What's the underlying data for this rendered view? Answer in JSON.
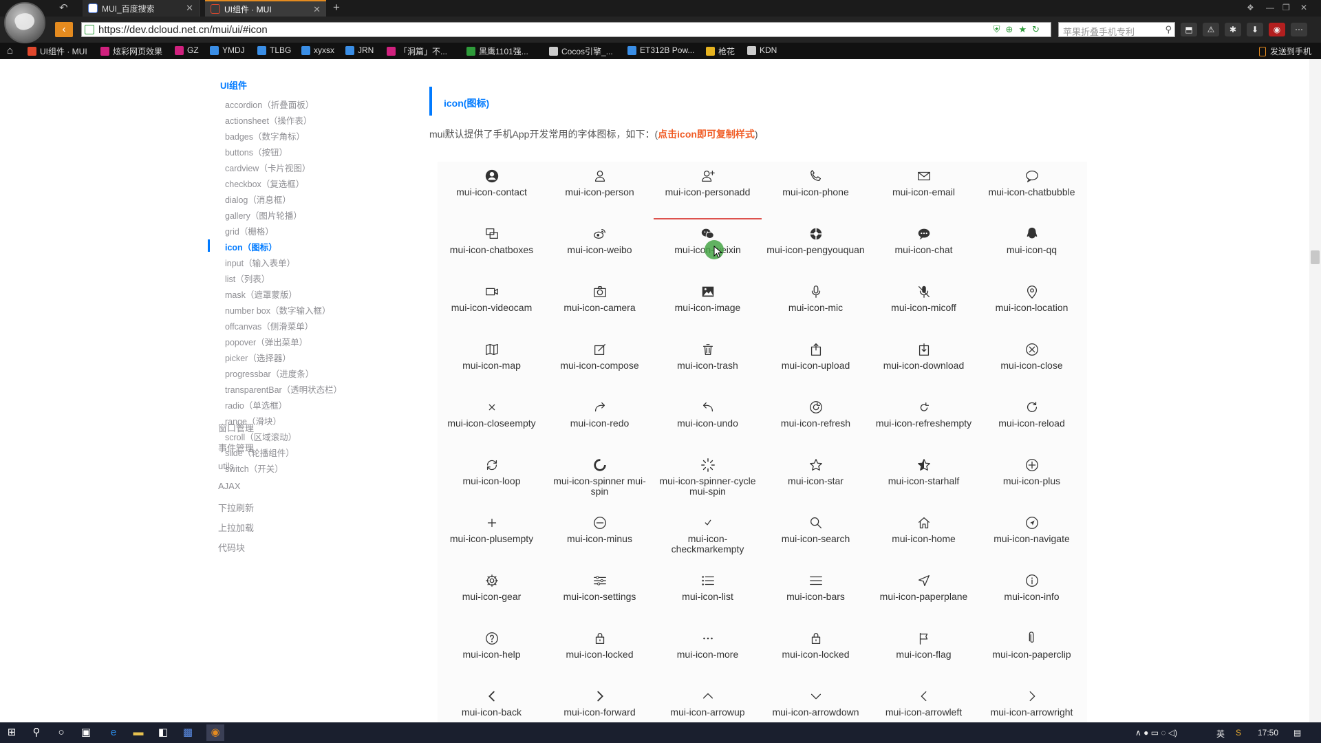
{
  "browser": {
    "tabs": [
      {
        "label": "MUI_百度搜索"
      },
      {
        "label": "UI组件 · MUI"
      }
    ],
    "url": "https://dev.dcloud.net.cn/mui/ui/#icon",
    "search_placeholder": "苹果折叠手机专利",
    "bookmarks": [
      {
        "label": "UI组件 · MUI",
        "color": "#e0472c"
      },
      {
        "label": "炫彩网页效果",
        "color": "#d0217e"
      },
      {
        "label": "GZ",
        "color": "#d0217e"
      },
      {
        "label": "YMDJ",
        "color": "#3a8ee6"
      },
      {
        "label": "TLBG",
        "color": "#3a8ee6"
      },
      {
        "label": "xyxsx",
        "color": "#3a8ee6"
      },
      {
        "label": "JRN",
        "color": "#3a8ee6"
      },
      {
        "label": "「洞篇」不...",
        "color": "#d0217e"
      },
      {
        "label": "黑鹰1101强...",
        "color": "#2e9b3a"
      },
      {
        "label": "Cocos引擎_...",
        "color": "#cccccc"
      },
      {
        "label": "ET312B Pow...",
        "color": "#3a8ee6"
      },
      {
        "label": "枪花",
        "color": "#e5b21f"
      },
      {
        "label": "KDN",
        "color": "#cccccc"
      }
    ],
    "send_to_phone": "发送到手机"
  },
  "sidebar": {
    "title": "UI组件",
    "items": [
      "accordion（折叠面板）",
      "actionsheet（操作表）",
      "badges（数字角标）",
      "buttons（按钮）",
      "cardview（卡片视图）",
      "checkbox（复选框）",
      "dialog（消息框）",
      "gallery（图片轮播）",
      "grid（栅格）",
      "icon（图标）",
      "input（输入表单）",
      "list（列表）",
      "mask（遮罩蒙版）",
      "number box（数字输入框）",
      "offcanvas（侧滑菜单）",
      "popover（弹出菜单）",
      "picker（选择器）",
      "progressbar（进度条）",
      "transparentBar（透明状态栏）",
      "radio（单选框）",
      "range（滑块）",
      "scroll（区域滚动）",
      "slide（轮播组件）",
      "switch（开关）"
    ],
    "active_index": 9,
    "groups": [
      "窗口管理",
      "事件管理",
      "utils",
      "AJAX",
      "下拉刷新",
      "上拉加载",
      "代码块"
    ]
  },
  "content": {
    "heading": "icon(图标)",
    "desc_prefix": "mui默认提供了手机App开发常用的字体图标，如下：(",
    "desc_highlight": "点击icon即可复制样式",
    "desc_suffix": ")",
    "accent": "#007aff",
    "highlight_color": "#f05b24",
    "active_icon_index": 2,
    "icons": [
      {
        "icon": "contact",
        "label": "mui-icon-contact"
      },
      {
        "icon": "person",
        "label": "mui-icon-person"
      },
      {
        "icon": "personadd",
        "label": "mui-icon-personadd"
      },
      {
        "icon": "phone",
        "label": "mui-icon-phone"
      },
      {
        "icon": "email",
        "label": "mui-icon-email"
      },
      {
        "icon": "chatbubble",
        "label": "mui-icon-chatbubble"
      },
      {
        "icon": "chatboxes",
        "label": "mui-icon-chatboxes"
      },
      {
        "icon": "weibo",
        "label": "mui-icon-weibo"
      },
      {
        "icon": "weixin",
        "label": "mui-icon-weixin"
      },
      {
        "icon": "pengyouquan",
        "label": "mui-icon-pengyouquan"
      },
      {
        "icon": "chat",
        "label": "mui-icon-chat"
      },
      {
        "icon": "qq",
        "label": "mui-icon-qq"
      },
      {
        "icon": "videocam",
        "label": "mui-icon-videocam"
      },
      {
        "icon": "camera",
        "label": "mui-icon-camera"
      },
      {
        "icon": "image",
        "label": "mui-icon-image"
      },
      {
        "icon": "mic",
        "label": "mui-icon-mic"
      },
      {
        "icon": "micoff",
        "label": "mui-icon-micoff"
      },
      {
        "icon": "location",
        "label": "mui-icon-location"
      },
      {
        "icon": "map",
        "label": "mui-icon-map"
      },
      {
        "icon": "compose",
        "label": "mui-icon-compose"
      },
      {
        "icon": "trash",
        "label": "mui-icon-trash"
      },
      {
        "icon": "upload",
        "label": "mui-icon-upload"
      },
      {
        "icon": "download",
        "label": "mui-icon-download"
      },
      {
        "icon": "close",
        "label": "mui-icon-close"
      },
      {
        "icon": "closeempty",
        "label": "mui-icon-closeempty"
      },
      {
        "icon": "redo",
        "label": "mui-icon-redo"
      },
      {
        "icon": "undo",
        "label": "mui-icon-undo"
      },
      {
        "icon": "refresh",
        "label": "mui-icon-refresh"
      },
      {
        "icon": "refreshempty",
        "label": "mui-icon-refreshempty"
      },
      {
        "icon": "reload",
        "label": "mui-icon-reload"
      },
      {
        "icon": "loop",
        "label": "mui-icon-loop"
      },
      {
        "icon": "spinner",
        "label": "mui-icon-spinner mui-spin"
      },
      {
        "icon": "spinner-cycle",
        "label": "mui-icon-spinner-cycle mui-spin"
      },
      {
        "icon": "star",
        "label": "mui-icon-star"
      },
      {
        "icon": "starhalf",
        "label": "mui-icon-starhalf"
      },
      {
        "icon": "plus",
        "label": "mui-icon-plus"
      },
      {
        "icon": "plusempty",
        "label": "mui-icon-plusempty"
      },
      {
        "icon": "minus",
        "label": "mui-icon-minus"
      },
      {
        "icon": "checkmarkempty",
        "label": "mui-icon-checkmarkempty"
      },
      {
        "icon": "search",
        "label": "mui-icon-search"
      },
      {
        "icon": "home",
        "label": "mui-icon-home"
      },
      {
        "icon": "navigate",
        "label": "mui-icon-navigate"
      },
      {
        "icon": "gear",
        "label": "mui-icon-gear"
      },
      {
        "icon": "settings",
        "label": "mui-icon-settings"
      },
      {
        "icon": "list",
        "label": "mui-icon-list"
      },
      {
        "icon": "bars",
        "label": "mui-icon-bars"
      },
      {
        "icon": "paperplane",
        "label": "mui-icon-paperplane"
      },
      {
        "icon": "info",
        "label": "mui-icon-info"
      },
      {
        "icon": "help",
        "label": "mui-icon-help"
      },
      {
        "icon": "locked",
        "label": "mui-icon-locked"
      },
      {
        "icon": "more",
        "label": "mui-icon-more"
      },
      {
        "icon": "locked",
        "label": "mui-icon-locked"
      },
      {
        "icon": "flag",
        "label": "mui-icon-flag"
      },
      {
        "icon": "paperclip",
        "label": "mui-icon-paperclip"
      },
      {
        "icon": "back",
        "label": "mui-icon-back"
      },
      {
        "icon": "forward",
        "label": "mui-icon-forward"
      },
      {
        "icon": "arrowup",
        "label": "mui-icon-arrowup"
      },
      {
        "icon": "arrowdown",
        "label": "mui-icon-arrowdown"
      },
      {
        "icon": "arrowleft",
        "label": "mui-icon-arrowleft"
      },
      {
        "icon": "arrowright",
        "label": "mui-icon-arrowright"
      }
    ]
  },
  "taskbar": {
    "ime": "英",
    "time": "17:50"
  }
}
